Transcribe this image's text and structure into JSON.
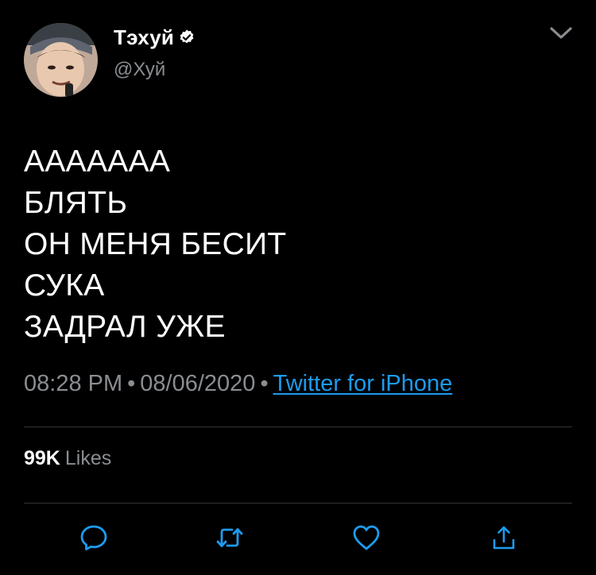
{
  "author": {
    "display_name": "Тэхуй",
    "handle": "@Хуй",
    "verified": true,
    "avatar_icon": "profile-photo"
  },
  "tweet": {
    "lines": [
      "АААААAА",
      "БЛЯТЬ",
      "ОН МЕНЯ БЕСИТ",
      "СУКА",
      "ЗАДРАЛ УЖЕ"
    ],
    "time": "08:28 PM",
    "date": "08/06/2020",
    "separator": "•",
    "source": "Twitter for iPhone"
  },
  "stats": {
    "likes_count": "99K",
    "likes_label": "Likes"
  },
  "actions": {
    "reply_icon": "reply-icon",
    "retweet_icon": "retweet-icon",
    "like_icon": "heart-icon",
    "share_icon": "share-icon"
  },
  "colors": {
    "background": "#000000",
    "text": "#ffffff",
    "secondary": "#8a8d91",
    "link": "#1d9bf0",
    "divider": "#2f3336"
  }
}
